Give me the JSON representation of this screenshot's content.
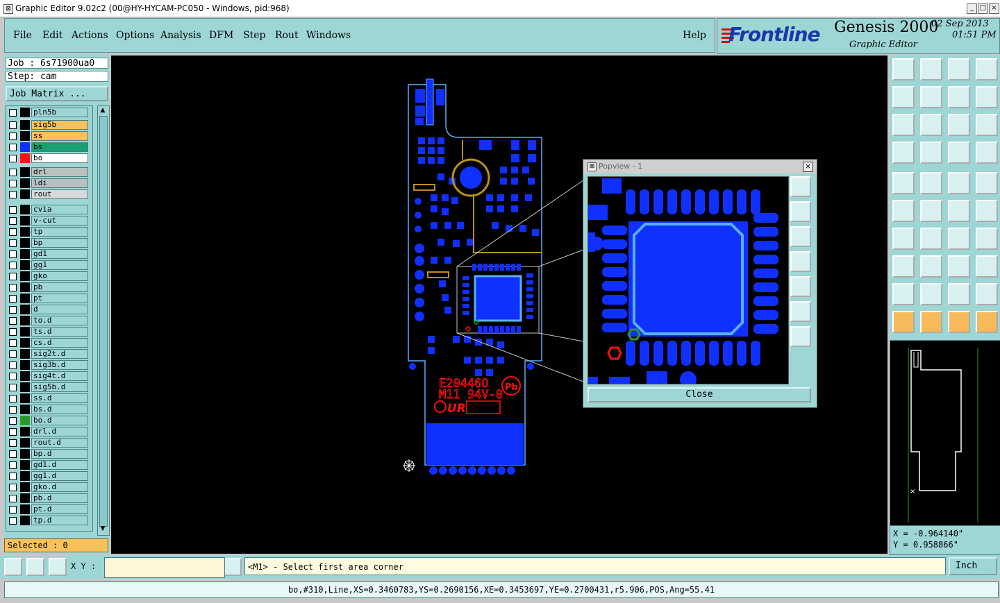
{
  "window": {
    "title": "Graphic Editor 9.02c2 (00@HY-HYCAM-PC050 - Windows, pid:968)"
  },
  "menu": [
    "File",
    "Edit",
    "Actions",
    "Options",
    "Analysis",
    "DFM",
    "Step",
    "Rout",
    "Windows"
  ],
  "help_label": "Help",
  "brand": {
    "logo": "Frontline",
    "product": "Genesis 2000",
    "subtitle": "Graphic Editor",
    "date": "02 Sep 2013",
    "time": "01:51 PM"
  },
  "job": {
    "job": "Job : 6s71900ua0",
    "step": "Step: cam",
    "matrix": "Job Matrix ..."
  },
  "layers": [
    {
      "name": "pln5b",
      "swatch": "#000000",
      "bg": "#9ed6d6"
    },
    {
      "name": "sig5b",
      "swatch": "#000000",
      "bg": "#f7c15c"
    },
    {
      "name": "ss",
      "swatch": "#000000",
      "bg": "#f7c15c"
    },
    {
      "name": "bs",
      "swatch": "#1030ff",
      "bg": "#1aa070"
    },
    {
      "name": "bo",
      "swatch": "#ff1010",
      "bg": "#ffffff"
    },
    {
      "name": "drl",
      "swatch": "#000000",
      "bg": "#b8c0c0"
    },
    {
      "name": "ldi",
      "swatch": "#000000",
      "bg": "#b8c0c0"
    },
    {
      "name": "rout",
      "swatch": "#000000",
      "bg": "#d8d8d8"
    },
    {
      "name": "cvia",
      "swatch": "#000000",
      "bg": "#9ed6d6"
    },
    {
      "name": "v-cut",
      "swatch": "#000000",
      "bg": "#9ed6d6"
    },
    {
      "name": "tp",
      "swatch": "#000000",
      "bg": "#9ed6d6"
    },
    {
      "name": "bp",
      "swatch": "#000000",
      "bg": "#9ed6d6"
    },
    {
      "name": "gd1",
      "swatch": "#000000",
      "bg": "#9ed6d6"
    },
    {
      "name": "gg1",
      "swatch": "#000000",
      "bg": "#9ed6d6"
    },
    {
      "name": "gko",
      "swatch": "#000000",
      "bg": "#9ed6d6"
    },
    {
      "name": "pb",
      "swatch": "#000000",
      "bg": "#9ed6d6"
    },
    {
      "name": "pt",
      "swatch": "#000000",
      "bg": "#9ed6d6"
    },
    {
      "name": "d",
      "swatch": "#000000",
      "bg": "#9ed6d6"
    },
    {
      "name": "to.d",
      "swatch": "#000000",
      "bg": "#9ed6d6"
    },
    {
      "name": "ts.d",
      "swatch": "#000000",
      "bg": "#9ed6d6"
    },
    {
      "name": "cs.d",
      "swatch": "#000000",
      "bg": "#9ed6d6"
    },
    {
      "name": "sig2t.d",
      "swatch": "#000000",
      "bg": "#9ed6d6"
    },
    {
      "name": "sig3b.d",
      "swatch": "#000000",
      "bg": "#9ed6d6"
    },
    {
      "name": "sig4t.d",
      "swatch": "#000000",
      "bg": "#9ed6d6"
    },
    {
      "name": "sig5b.d",
      "swatch": "#000000",
      "bg": "#9ed6d6"
    },
    {
      "name": "ss.d",
      "swatch": "#000000",
      "bg": "#9ed6d6"
    },
    {
      "name": "bs.d",
      "swatch": "#000000",
      "bg": "#9ed6d6"
    },
    {
      "name": "bo.d",
      "swatch": "#2a9a2a",
      "bg": "#9ed6d6"
    },
    {
      "name": "drl.d",
      "swatch": "#000000",
      "bg": "#9ed6d6"
    },
    {
      "name": "rout.d",
      "swatch": "#000000",
      "bg": "#9ed6d6"
    },
    {
      "name": "bp.d",
      "swatch": "#000000",
      "bg": "#9ed6d6"
    },
    {
      "name": "gd1.d",
      "swatch": "#000000",
      "bg": "#9ed6d6"
    },
    {
      "name": "gg1.d",
      "swatch": "#000000",
      "bg": "#9ed6d6"
    },
    {
      "name": "gko.d",
      "swatch": "#000000",
      "bg": "#9ed6d6"
    },
    {
      "name": "pb.d",
      "swatch": "#000000",
      "bg": "#9ed6d6"
    },
    {
      "name": "pt.d",
      "swatch": "#000000",
      "bg": "#9ed6d6"
    },
    {
      "name": "tp.d",
      "swatch": "#000000",
      "bg": "#9ed6d6"
    }
  ],
  "selected": "Selected : 0",
  "popview": {
    "title": "Popview - 1",
    "close": "Close"
  },
  "silkscreen": {
    "line1": "E20446O",
    "line2": "M11 94V-0",
    "logo": "UR",
    "badge": "Pb"
  },
  "coords": {
    "x": "X = -0.964140\"",
    "y": "Y = 0.958866\""
  },
  "bottom": {
    "xy_label": "X Y :",
    "xy_value": "",
    "message": "<M1> - Select first area corner",
    "unit": "Inch",
    "status": "bo,#310,Line,XS=0.3460783,YS=0.2690156,XE=0.3453697,YE=0.2700431,r5.906,POS,Ang=55.41"
  },
  "colors": {
    "panel": "#9ed6d6",
    "copper": "#1030ff",
    "outline": "#5ab0ff",
    "silk": "#ff1010",
    "trace": "#b8901a"
  }
}
